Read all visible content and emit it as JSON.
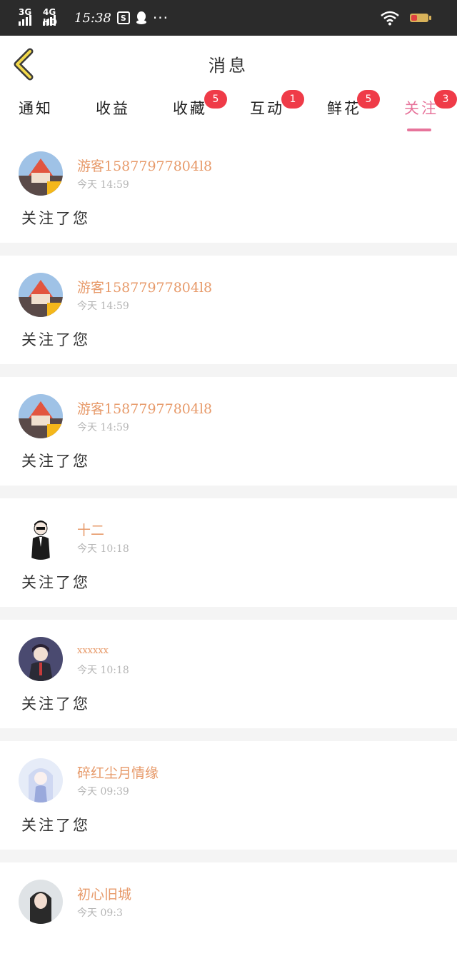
{
  "status_bar": {
    "signal_1": "3G",
    "signal_2": "4G HD",
    "time": "15:38",
    "more": "···"
  },
  "header": {
    "title": "消息"
  },
  "tabs": [
    {
      "label": "通知",
      "badge": ""
    },
    {
      "label": "收益",
      "badge": ""
    },
    {
      "label": "收藏",
      "badge": "5"
    },
    {
      "label": "互动",
      "badge": "1"
    },
    {
      "label": "鲜花",
      "badge": "5"
    },
    {
      "label": "关注",
      "badge": "3",
      "active": true
    }
  ],
  "messages": [
    {
      "name": "游客15877977804l8",
      "time": "今天 14:59",
      "text": "关注了您",
      "avatar": "temple"
    },
    {
      "name": "游客15877977804l8",
      "time": "今天 14:59",
      "text": "关注了您",
      "avatar": "temple"
    },
    {
      "name": "游客15877977804l8",
      "time": "今天 14:59",
      "text": "关注了您",
      "avatar": "temple"
    },
    {
      "name": "十二",
      "time": "今天 10:18",
      "text": "关注了您",
      "avatar": "man-suit"
    },
    {
      "name": "xxxxxx",
      "time": "今天 10:18",
      "text": "关注了您",
      "avatar": "anime-boy"
    },
    {
      "name": "碎红尘月情缘",
      "time": "今天 09:39",
      "text": "关注了您",
      "avatar": "anime-girl"
    },
    {
      "name": "初心旧城",
      "time": "今天 09:3",
      "text": "",
      "avatar": "girl-photo"
    }
  ]
}
